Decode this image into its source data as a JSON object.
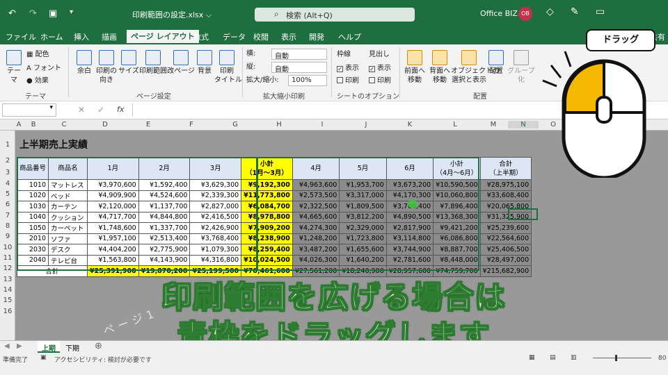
{
  "titlebar": {
    "filename": "印刷範囲の設定.xlsx ⌵",
    "search": "検索 (Alt+Q)",
    "account": "Office BIZ",
    "avatar": "OB"
  },
  "menu": [
    "ファイル",
    "ホーム",
    "挿入",
    "描画",
    "ページ レイアウト",
    "数式",
    "データ",
    "校閲",
    "表示",
    "開発",
    "ヘルプ"
  ],
  "menu_active_index": 4,
  "menu_extra": "共有",
  "ribbon": {
    "theme": {
      "theme_btn": "テーマ",
      "colors": "配色",
      "fonts": "フォント",
      "effects": "効果",
      "group": "テーマ"
    },
    "page_setup": {
      "margins": "余白",
      "orientation": "印刷の\n向き",
      "size": "サイズ",
      "print_area": "印刷範囲",
      "breaks": "改ページ",
      "background": "背景",
      "print_titles": "印刷\nタイトル",
      "group": "ページ設定"
    },
    "scale": {
      "width_label": "横:",
      "width_value": "自動",
      "height_label": "縦:",
      "height_value": "自動",
      "scale_label": "拡大/縮小:",
      "scale_value": "100%",
      "group": "拡大縮小印刷"
    },
    "sheet_options": {
      "gridlines": "枠線",
      "headings": "見出し",
      "view": "表示",
      "print": "印刷",
      "group": "シートのオプション"
    },
    "arrange": {
      "forward": "前面へ\n移動",
      "backward": "背面へ\n移動",
      "selection": "オブジェクトの\n選択と表示",
      "align": "配置",
      "group_btn": "グループ化",
      "group": "配置"
    }
  },
  "formula": {
    "fx": "fx"
  },
  "columns": [
    "A",
    "B",
    "C",
    "D",
    "E",
    "F",
    "G",
    "H",
    "I",
    "J",
    "K",
    "L",
    "M",
    "N",
    "O",
    "R"
  ],
  "rows": [
    "1",
    "2",
    "3",
    "4",
    "5",
    "6",
    "7",
    "8",
    "9",
    "10",
    "11",
    "12",
    "13",
    "14",
    "15",
    "16"
  ],
  "sheet_title": "上半期売上実績",
  "table": {
    "headers": [
      "商品番号",
      "商品名",
      "1月",
      "2月",
      "3月",
      "小計\n（1月～3月）",
      "4月",
      "5月",
      "6月",
      "小計\n（4月～6月）",
      "合計\n（上半期）"
    ],
    "rows": [
      [
        "1010",
        "マットレス",
        "¥3,970,600",
        "¥1,592,400",
        "¥3,629,300",
        "¥9,192,300",
        "¥4,963,600",
        "¥1,953,700",
        "¥3,673,200",
        "¥10,590,500",
        "¥28,975,100"
      ],
      [
        "1020",
        "ベッド",
        "¥4,909,900",
        "¥4,524,600",
        "¥2,339,300",
        "¥11,773,800",
        "¥2,573,500",
        "¥3,317,000",
        "¥4,170,300",
        "¥10,060,800",
        "¥33,608,400"
      ],
      [
        "1030",
        "カーテン",
        "¥2,120,000",
        "¥1,137,700",
        "¥2,827,000",
        "¥6,084,700",
        "¥2,322,500",
        "¥1,809,500",
        "¥3,764,400",
        "¥7,896,400",
        "¥20,065,800"
      ],
      [
        "1040",
        "クッション",
        "¥4,717,700",
        "¥4,844,800",
        "¥2,416,500",
        "¥8,978,800",
        "¥4,665,600",
        "¥3,812,200",
        "¥4,890,500",
        "¥13,368,300",
        "¥31,325,900"
      ],
      [
        "1050",
        "カーペット",
        "¥1,748,600",
        "¥1,337,700",
        "¥2,426,900",
        "¥7,909,200",
        "¥4,274,300",
        "¥2,329,000",
        "¥2,817,900",
        "¥9,421,200",
        "¥25,239,600"
      ],
      [
        "2010",
        "ソファ",
        "¥1,957,100",
        "¥2,513,400",
        "¥3,768,400",
        "¥8,238,900",
        "¥1,248,200",
        "¥1,723,800",
        "¥3,114,800",
        "¥6,086,800",
        "¥22,564,600"
      ],
      [
        "2030",
        "デスク",
        "¥4,404,200",
        "¥2,775,900",
        "¥1,079,300",
        "¥8,259,400",
        "¥3,487,200",
        "¥1,655,600",
        "¥3,744,900",
        "¥8,887,700",
        "¥25,406,500"
      ],
      [
        "2040",
        "テレビ台",
        "¥1,563,800",
        "¥4,143,900",
        "¥4,316,800",
        "¥10,024,500",
        "¥4,026,300",
        "¥1,640,200",
        "¥2,781,600",
        "¥8,448,000",
        "¥28,497,000"
      ]
    ],
    "total": [
      "合計",
      "¥25,391,900",
      "¥19,870,200",
      "¥25,199,500",
      "¥70,461,600",
      "¥27,561,200",
      "¥18,240,900",
      "¥28,957,600",
      "¥74,759,700",
      "¥215,682,900"
    ]
  },
  "watermark": "ページ1",
  "subtitle_line1": "印刷範囲を広げる場合は",
  "subtitle_line2": "青枠をドラッグします",
  "callout": "ドラッグ",
  "tabs": [
    "上期",
    "下期"
  ],
  "status": {
    "ready": "準備完了",
    "accessibility": "アクセシビリティ: 検討が必要です",
    "zoom": "80"
  },
  "colors": {
    "excel_green": "#1e6e3f",
    "highlight_yellow": "#ffff00",
    "mouse_yellow": "#f5b800"
  }
}
